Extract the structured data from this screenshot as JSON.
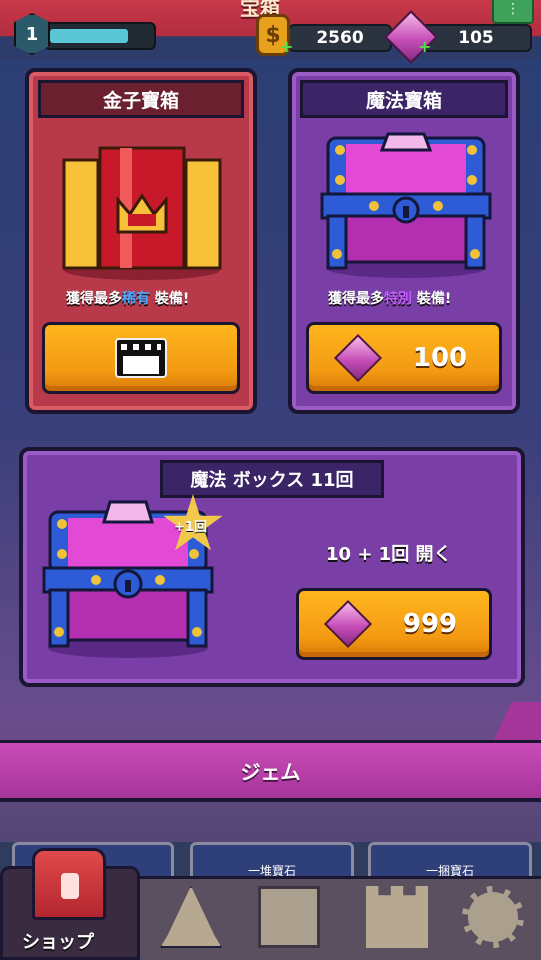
{
  "header": {
    "title": "宝箱",
    "level": "1",
    "xp_fraction": 0.72,
    "gold_amount": "2560",
    "gem_amount": "105"
  },
  "gold_chest": {
    "title": "金子寶箱",
    "desc_prefix": "獲得最多",
    "desc_highlight": "稀有",
    "desc_suffix": " 裝備!"
  },
  "magic_chest": {
    "title": "魔法寶箱",
    "desc_prefix": "獲得最多",
    "desc_highlight": "特別",
    "desc_suffix": " 裝備!",
    "price": "100"
  },
  "magic_box": {
    "title": "魔法 ボックス 11回",
    "bonus": "+1回",
    "open_text": "10 + 1回 開く",
    "price": "999"
  },
  "section": {
    "gem_label": "ジェム"
  },
  "peek_cards": [
    "",
    "一堆寶石",
    "一捆寶石"
  ],
  "nav": {
    "shop_label": "ショップ"
  }
}
